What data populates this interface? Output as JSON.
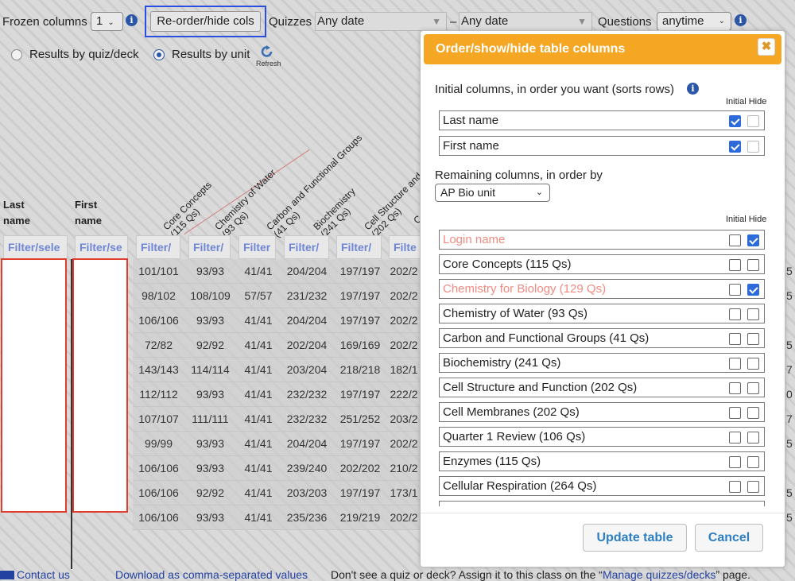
{
  "toolbar": {
    "frozen_label": "Frozen columns",
    "frozen_value": "1",
    "reorder_label": "Re-order/hide cols",
    "quizzes_label": "Quizzes",
    "date_from": "Any date",
    "date_sep": "–",
    "date_to": "Any date",
    "questions_label": "Questions",
    "questions_value": "anytime",
    "radio_quiz": "Results by quiz/deck",
    "radio_unit": "Results by unit",
    "refresh_label": "Refresh"
  },
  "table": {
    "fixed_headers": [
      {
        "line1": "Last",
        "line2": "name"
      },
      {
        "line1": "First",
        "line2": "name"
      }
    ],
    "rotated_headers": [
      {
        "line1": "Core Concepts",
        "line2": "(115 Qs)"
      },
      {
        "line1": "Chemistry of Water",
        "line2": "(93 Qs)"
      },
      {
        "line1": "Carbon and Functional Groups",
        "line2": "(41 Qs)"
      },
      {
        "line1": "Biochemistry",
        "line2": "(241 Qs)"
      },
      {
        "line1": "Cell Structure and Function",
        "line2": "(202 Qs)"
      },
      {
        "line1": "C",
        "line2": ""
      }
    ],
    "filters": [
      "Filter/sele",
      "Filter/se",
      "Filter/",
      "Filter/",
      "Filter",
      "Filter/",
      "Filter/",
      "Filte"
    ],
    "rows": [
      [
        "101/101",
        "93/93",
        "41/41",
        "204/204",
        "197/197",
        "202/2"
      ],
      [
        "98/102",
        "108/109",
        "57/57",
        "231/232",
        "197/197",
        "202/2"
      ],
      [
        "106/106",
        "93/93",
        "41/41",
        "204/204",
        "197/197",
        "202/2"
      ],
      [
        "72/82",
        "92/92",
        "41/41",
        "202/204",
        "169/169",
        "202/2"
      ],
      [
        "143/143",
        "114/114",
        "41/41",
        "203/204",
        "218/218",
        "182/1"
      ],
      [
        "112/112",
        "93/93",
        "41/41",
        "232/232",
        "197/197",
        "222/2"
      ],
      [
        "107/107",
        "111/111",
        "41/41",
        "232/232",
        "251/252",
        "203/2"
      ],
      [
        "99/99",
        "93/93",
        "41/41",
        "204/204",
        "197/197",
        "202/2"
      ],
      [
        "106/106",
        "93/93",
        "41/41",
        "239/240",
        "202/202",
        "210/2"
      ],
      [
        "106/106",
        "92/92",
        "41/41",
        "203/203",
        "197/197",
        "173/1"
      ],
      [
        "106/106",
        "93/93",
        "41/41",
        "235/236",
        "219/219",
        "202/2"
      ]
    ],
    "right_edge": [
      "5",
      "5",
      "",
      "5",
      "7",
      "0",
      "7",
      "5",
      "",
      "5",
      "5"
    ]
  },
  "footer": {
    "contact": "Contact us",
    "download": "Download as comma-separated values",
    "prompt": "Don't see a quiz or deck?  Assign it to this class on the “",
    "manage_link": "Manage quizzes/decks",
    "suffix": "” page."
  },
  "modal": {
    "title": "Order/show/hide table columns",
    "close": "✖",
    "initial_label": "Initial columns, in order you want (sorts rows)",
    "initial_hide": "Initial Hide",
    "initial_columns": [
      {
        "name": "Last name",
        "hide": false,
        "locked": true
      },
      {
        "name": "First name",
        "hide": false,
        "locked": true
      }
    ],
    "remaining_label": "Remaining columns, in order by",
    "order_by": "AP Bio unit",
    "remaining_hide": "Initial Hide",
    "remaining_columns": [
      {
        "name": "Login name",
        "hidden": true
      },
      {
        "name": "Core Concepts (115 Qs)",
        "hidden": false
      },
      {
        "name": "Chemistry for Biology (129 Qs)",
        "hidden": true
      },
      {
        "name": "Chemistry of Water (93 Qs)",
        "hidden": false
      },
      {
        "name": "Carbon and Functional Groups (41 Qs)",
        "hidden": false
      },
      {
        "name": "Biochemistry (241 Qs)",
        "hidden": false
      },
      {
        "name": "Cell Structure and Function (202 Qs)",
        "hidden": false
      },
      {
        "name": "Cell Membranes (202 Qs)",
        "hidden": false
      },
      {
        "name": "Quarter 1 Review (106 Qs)",
        "hidden": false
      },
      {
        "name": "Enzymes (115 Qs)",
        "hidden": false
      },
      {
        "name": "Cellular Respiration (264 Qs)",
        "hidden": false
      }
    ],
    "update_button": "Update table",
    "cancel_button": "Cancel"
  },
  "colors": {
    "accent": "#f5a623",
    "link": "#2341a0",
    "button_text": "#2d7fc1",
    "hidden_text": "#f28b82",
    "highlight_border": "#2a4fe0",
    "empty_cell_border": "#e03d2e"
  }
}
